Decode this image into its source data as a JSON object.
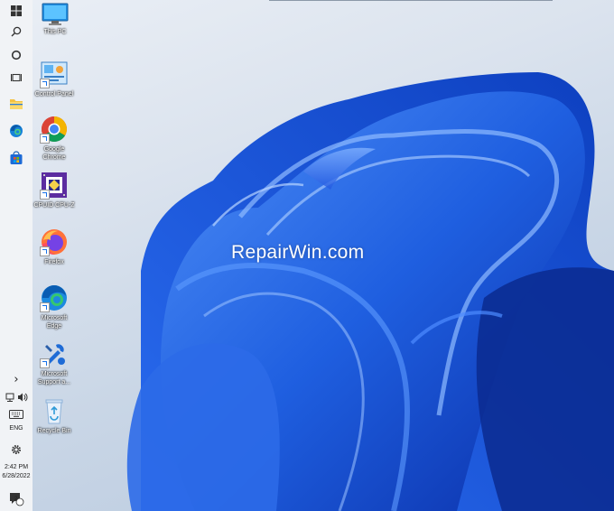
{
  "taskbar": {
    "chevron": "›",
    "language": "ENG",
    "clock": {
      "time": "2:42 PM",
      "date": "6/28/2022"
    },
    "notification_count": "2"
  },
  "desktop_icons": [
    {
      "label": "This PC"
    },
    {
      "label": "Control Panel"
    },
    {
      "label": "Google\nChrome"
    },
    {
      "label": "CPUID CPU-Z"
    },
    {
      "label": "Firefox"
    },
    {
      "label": "Microsoft\nEdge"
    },
    {
      "label": "Microsoft\nSupport a..."
    },
    {
      "label": "Recycle Bin"
    }
  ],
  "watermark": "RepairWin.com",
  "colors": {
    "wallpaper_blue": "#1f5fe0",
    "taskbar_bg": "#f1f3f6"
  }
}
